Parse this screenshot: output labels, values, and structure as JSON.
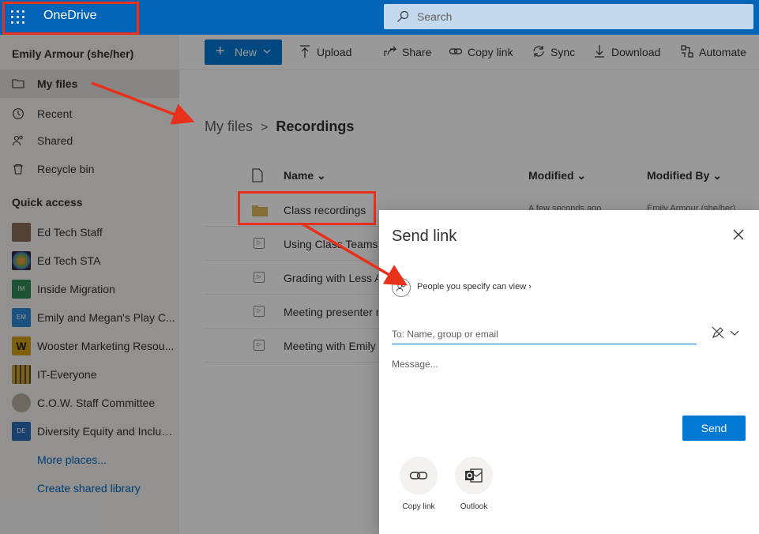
{
  "topbar": {
    "brand": "OneDrive",
    "search_placeholder": "Search"
  },
  "user": {
    "name": "Emily Armour (she/her)"
  },
  "nav": [
    {
      "label": "My files",
      "icon": "folder-icon",
      "selected": true
    },
    {
      "label": "Recent",
      "icon": "clock-icon",
      "selected": false
    },
    {
      "label": "Shared",
      "icon": "people-icon",
      "selected": false
    },
    {
      "label": "Recycle bin",
      "icon": "recycle-bin-icon",
      "selected": false
    }
  ],
  "quick_access": {
    "heading": "Quick access",
    "items": [
      {
        "label": "Ed Tech Staff",
        "thumb": "",
        "color": "#8a6d5a"
      },
      {
        "label": "Ed Tech STA",
        "thumb": "",
        "color": "#3a2a4a"
      },
      {
        "label": "Inside Migration",
        "thumb": "IM",
        "color": "#2e8b57"
      },
      {
        "label": "Emily and Megan's Play C...",
        "thumb": "EM",
        "color": "#2b88d8"
      },
      {
        "label": "Wooster Marketing Resou...",
        "thumb": "W",
        "color": "#d4a017"
      },
      {
        "label": "IT-Everyone",
        "thumb": "",
        "color": "#c8a23a"
      },
      {
        "label": "C.O.W. Staff Committee",
        "thumb": "",
        "color": "#b8b0a0"
      },
      {
        "label": "Diversity Equity and Inclus...",
        "thumb": "DE",
        "color": "#2b6cb8"
      }
    ],
    "more": "More places...",
    "create": "Create shared library"
  },
  "commands": {
    "new": "New",
    "upload": "Upload",
    "share": "Share",
    "copy_link": "Copy link",
    "sync": "Sync",
    "download": "Download",
    "automate": "Automate"
  },
  "breadcrumb": {
    "root": "My files",
    "current": "Recordings"
  },
  "columns": {
    "name": "Name",
    "modified": "Modified",
    "modified_by": "Modified By"
  },
  "files": [
    {
      "name": "Class recordings",
      "type": "folder",
      "modified": "A few seconds ago",
      "modified_by": "Emily Armour (she/her)"
    },
    {
      "name": "Using Class Teams f",
      "type": "video",
      "modified": "",
      "modified_by": ""
    },
    {
      "name": "Grading with Less A",
      "type": "video",
      "modified": "",
      "modified_by": ""
    },
    {
      "name": "Meeting presenter r",
      "type": "video",
      "modified": "",
      "modified_by": ""
    },
    {
      "name": "Meeting with Emily",
      "type": "video",
      "modified": "",
      "modified_by": ""
    }
  ],
  "dialog": {
    "title": "Send link",
    "permission": "People you specify can view",
    "to_placeholder": "To: Name, group or email",
    "message_placeholder": "Message...",
    "send": "Send",
    "options": [
      {
        "label": "Copy link",
        "icon": "link-icon"
      },
      {
        "label": "Outlook",
        "icon": "outlook-icon"
      }
    ]
  },
  "colors": {
    "accent": "#0078d4",
    "topbar": "#0364b8",
    "annotation": "#e8311a"
  }
}
